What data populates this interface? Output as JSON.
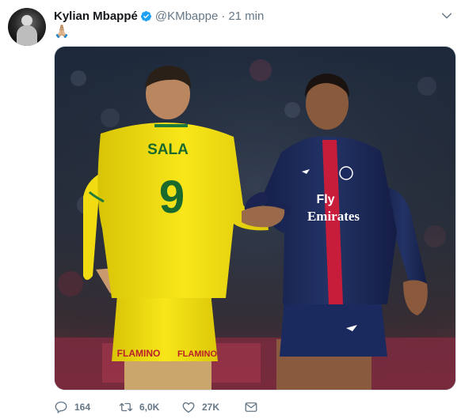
{
  "author": {
    "name": "Kylian Mbappé",
    "handle": "@KMbappe",
    "separator": "·",
    "time": "21 min"
  },
  "tweet": {
    "text": "🙏🏼"
  },
  "photo": {
    "left_player_shirt_name": "SALA",
    "left_player_number": "9",
    "left_sponsor": "FLAMINO",
    "right_sponsor_line1": "Fly",
    "right_sponsor_line2": "Emirates"
  },
  "actions": {
    "replies": "164",
    "retweets": "6,0K",
    "likes": "27K"
  },
  "colors": {
    "verified": "#1da1f2",
    "muted": "#657786",
    "nantes_yellow": "#f5e20b",
    "psg_navy": "#1c2a5c",
    "psg_red": "#d81c3a"
  },
  "icons": [
    "verified-icon",
    "caret-down-icon",
    "reply-icon",
    "retweet-icon",
    "like-icon",
    "message-icon"
  ]
}
